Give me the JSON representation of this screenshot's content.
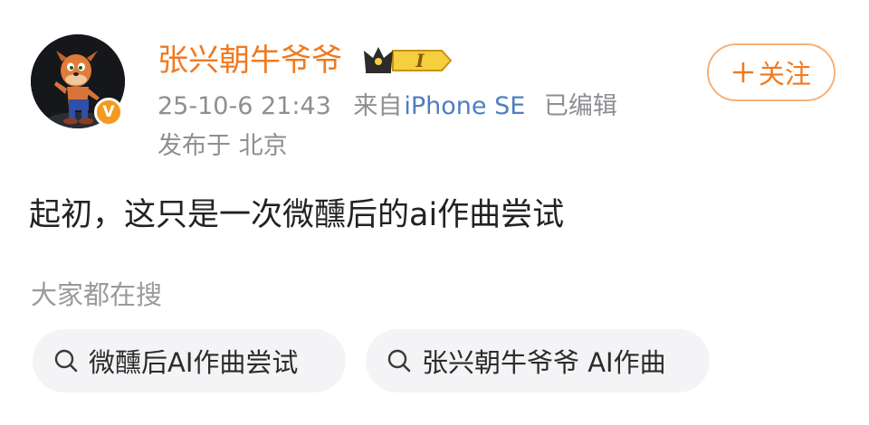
{
  "post_header": {
    "username": "张兴朝牛爷爷",
    "level_badge": "I",
    "verified_mark": "V",
    "timestamp": "25-10-6 21:43",
    "source_prefix": "来自",
    "device": "iPhone SE",
    "edited_label": "已编辑",
    "location": "发布于 北京",
    "follow_button": {
      "icon": "plus-icon",
      "label": "关注"
    }
  },
  "post": {
    "text": "起初，这只是一次微醺后的ai作曲尝试"
  },
  "search_suggestions": {
    "heading": "大家都在搜",
    "chips": [
      {
        "icon": "search-icon",
        "label": "微醺后AI作曲尝试"
      },
      {
        "icon": "search-icon",
        "label": "张兴朝牛爷爷 AI作曲"
      }
    ]
  },
  "colors": {
    "accent_orange": "#f07a20",
    "link_blue": "#4f7fbd",
    "meta_gray": "#8e8e93",
    "chip_bg": "#f4f4f6"
  }
}
